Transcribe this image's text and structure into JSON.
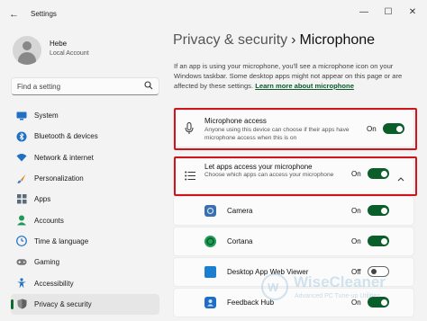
{
  "window": {
    "title": "Settings",
    "back_glyph": "←",
    "minimize_glyph": "—",
    "maximize_glyph": "☐",
    "close_glyph": "✕"
  },
  "account": {
    "name": "Hebe",
    "type": "Local Account"
  },
  "search": {
    "placeholder": "Find a setting",
    "icon": "search-icon"
  },
  "nav": {
    "items": [
      {
        "label": "System",
        "icon": "monitor-icon",
        "color": "#1f6fc5"
      },
      {
        "label": "Bluetooth & devices",
        "icon": "bluetooth-icon",
        "color": "#1f6fc5"
      },
      {
        "label": "Network & internet",
        "icon": "wifi-icon",
        "color": "#1f6fc5"
      },
      {
        "label": "Personalization",
        "icon": "paintbrush-icon",
        "color": "#d47a1e"
      },
      {
        "label": "Apps",
        "icon": "apps-icon",
        "color": "#5a6b7a"
      },
      {
        "label": "Accounts",
        "icon": "person-icon",
        "color": "#1d9a58"
      },
      {
        "label": "Time & language",
        "icon": "globe-clock-icon",
        "color": "#1f6fc5"
      },
      {
        "label": "Gaming",
        "icon": "gamepad-icon",
        "color": "#777777"
      },
      {
        "label": "Accessibility",
        "icon": "accessibility-icon",
        "color": "#1f6fc5"
      },
      {
        "label": "Privacy & security",
        "icon": "shield-icon",
        "color": "#666666",
        "active": true
      }
    ]
  },
  "breadcrumb": {
    "parent": "Privacy & security",
    "separator": "›",
    "current": "Microphone"
  },
  "intro": {
    "text": "If an app is using your microphone, you'll see a microphone icon on your Windows taskbar. Some desktop apps might not appear on this page or are affected by these settings.",
    "link": "Learn more about microphone"
  },
  "microphone_access": {
    "title": "Microphone access",
    "description": "Anyone using this device can choose if their apps have microphone access when this is on",
    "state": "On",
    "enabled": true,
    "icon": "microphone-icon"
  },
  "app_access": {
    "title": "Let apps access your microphone",
    "description": "Choose which apps can access your microphone",
    "state": "On",
    "enabled": true,
    "icon": "list-icon",
    "chevron": "chevron-up-icon"
  },
  "apps": [
    {
      "name": "Camera",
      "state": "On",
      "enabled": true,
      "color": "#3a6fb0"
    },
    {
      "name": "Cortana",
      "state": "On",
      "enabled": true,
      "color": "#1e9e57"
    },
    {
      "name": "Desktop App Web Viewer",
      "state": "Off",
      "enabled": false,
      "color": "#1b7fd1"
    },
    {
      "name": "Feedback Hub",
      "state": "On",
      "enabled": true,
      "color": "#1e6ec8"
    }
  ],
  "watermark": {
    "name": "WiseCleaner",
    "tagline": "Advanced PC Tune-up Utilities"
  },
  "colors": {
    "accent": "#0b5d2a",
    "highlight": "#d0141c"
  }
}
